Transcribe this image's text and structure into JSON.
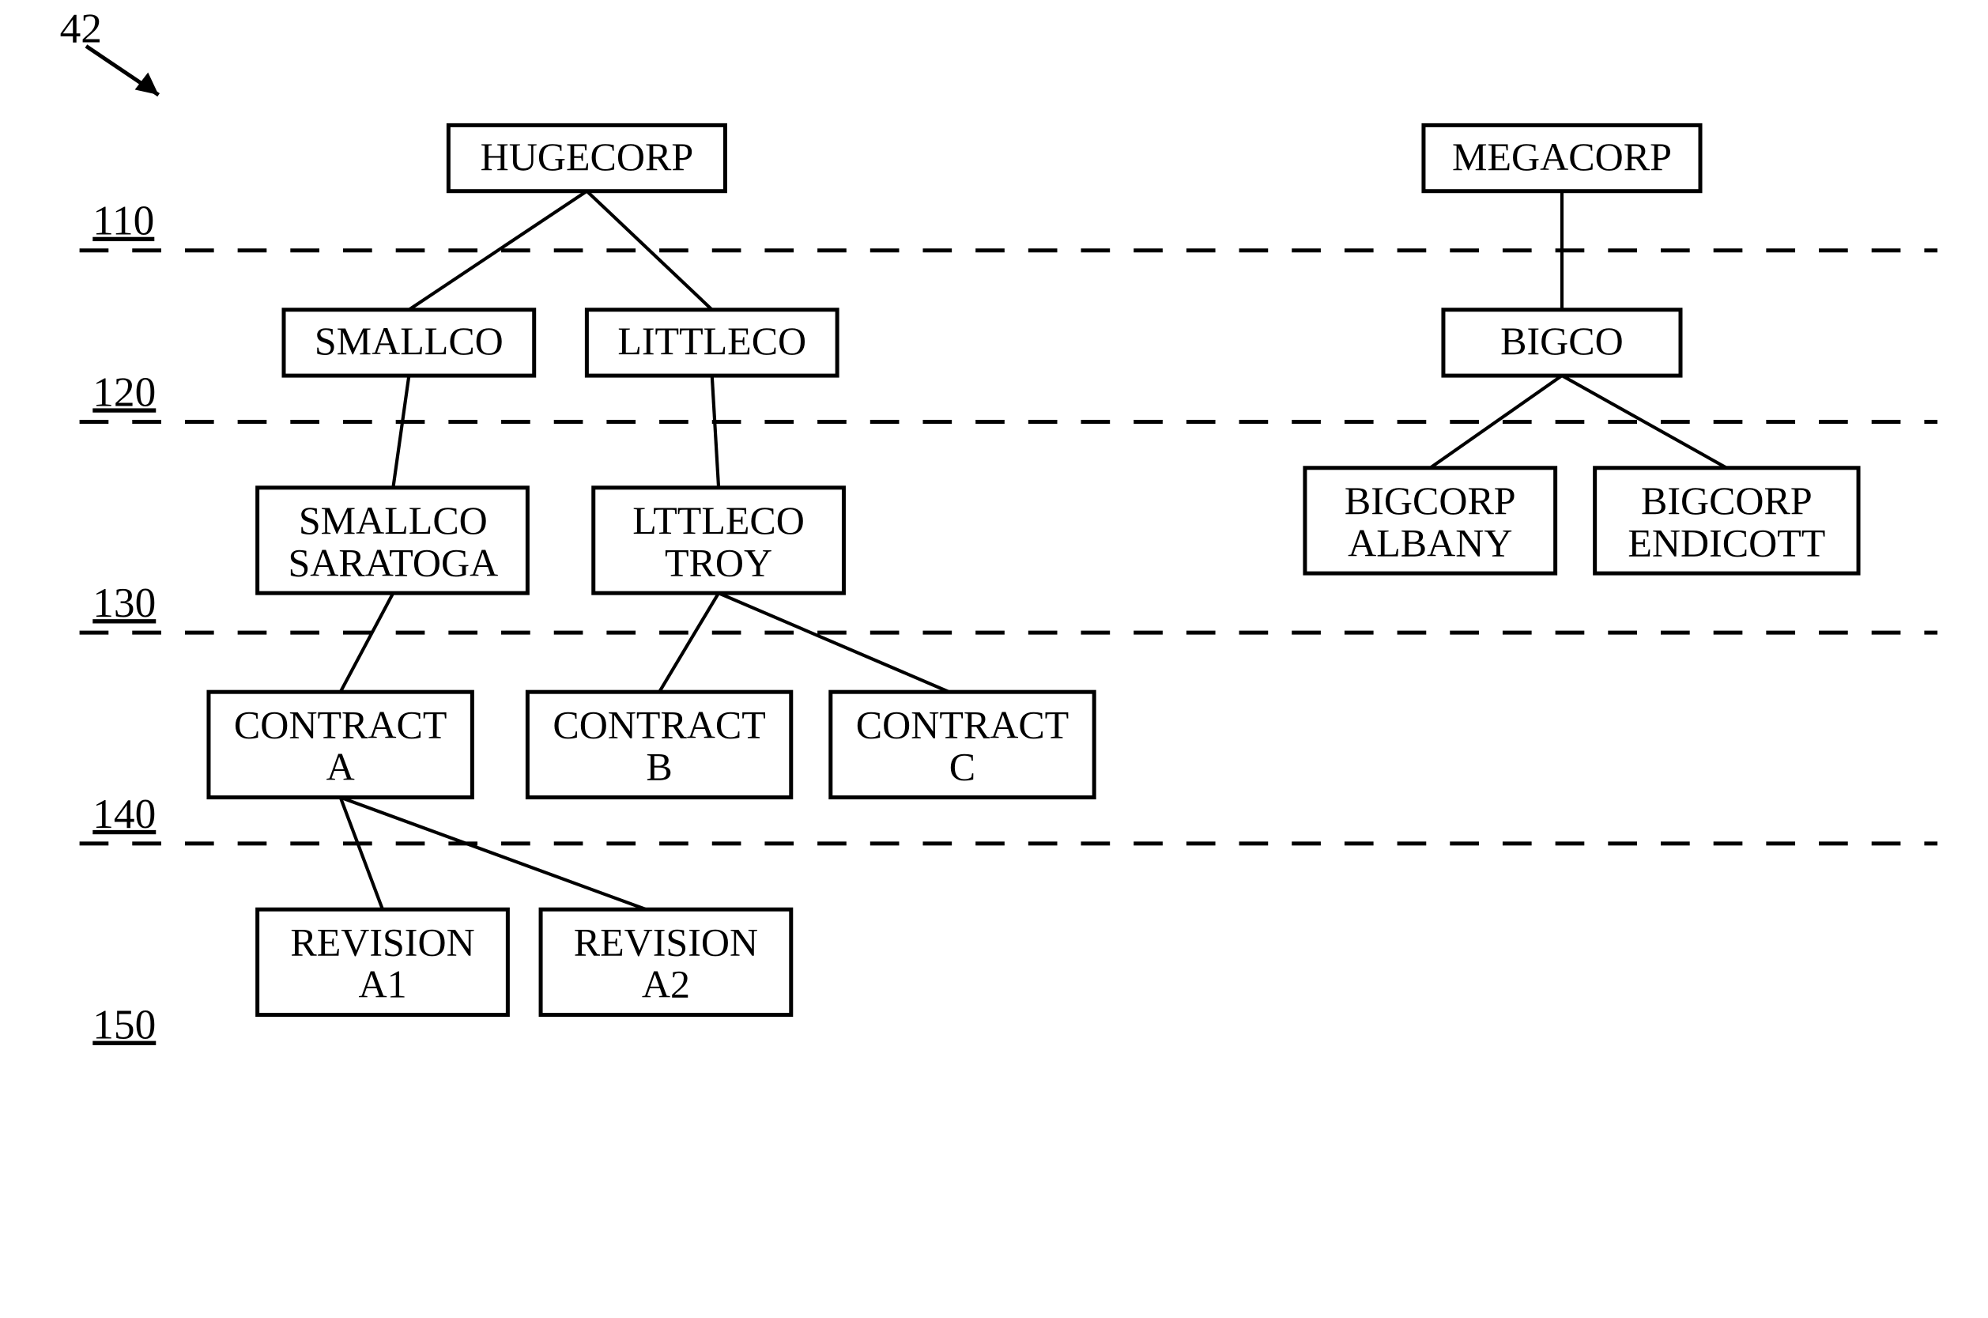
{
  "figure_ref": "42",
  "levels": {
    "l110": "110",
    "l120": "120",
    "l130": "130",
    "l140": "140",
    "l150": "150"
  },
  "nodes": {
    "hugecorp": "HUGECORP",
    "megacorp": "MEGACORP",
    "smallco": "SMALLCO",
    "littleco": "LITTLECO",
    "bigco": "BIGCO",
    "smallco_saratoga_l1": "SMALLCO",
    "smallco_saratoga_l2": "SARATOGA",
    "lttleco_troy_l1": "LTTLECO",
    "lttleco_troy_l2": "TROY",
    "bigcorp_albany_l1": "BIGCORP",
    "bigcorp_albany_l2": "ALBANY",
    "bigcorp_endicott_l1": "BIGCORP",
    "bigcorp_endicott_l2": "ENDICOTT",
    "contract_a_l1": "CONTRACT",
    "contract_a_l2": "A",
    "contract_b_l1": "CONTRACT",
    "contract_b_l2": "B",
    "contract_c_l1": "CONTRACT",
    "contract_c_l2": "C",
    "revision_a1_l1": "REVISION",
    "revision_a1_l2": "A1",
    "revision_a2_l1": "REVISION",
    "revision_a2_l2": "A2"
  }
}
